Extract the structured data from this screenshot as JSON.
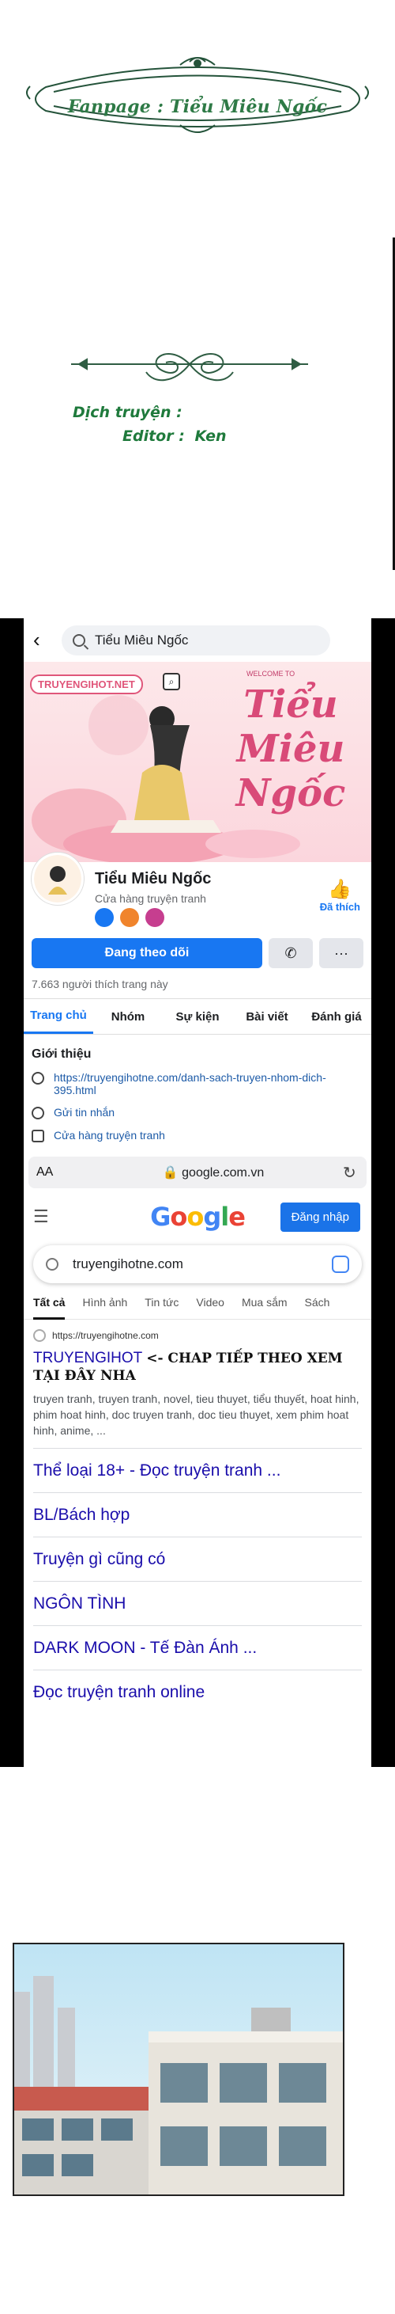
{
  "credits": {
    "fanpage": "Fanpage : Tiểu Miêu Ngốc",
    "translator_label": "Dịch truyện :",
    "editor_label": "Editor :",
    "editor_name": "Ken"
  },
  "facebook": {
    "search_query": "Tiểu Miêu Ngốc",
    "cover_badge": "TRUYENGIHOT.NET",
    "cover_welcome": "WELCOME TO",
    "cover_title": "Tiểu Miêu Ngốc",
    "page_name": "Tiểu Miêu Ngốc",
    "category": "Cửa hàng truyện tranh",
    "liked_label": "Đã thích",
    "follow_label": "Đang theo dõi",
    "likes_count": "7.663 người thích trang này",
    "tabs": [
      "Trang chủ",
      "Nhóm",
      "Sự kiện",
      "Bài viết",
      "Đánh giá"
    ],
    "intro_title": "Giới thiệu",
    "intro_link": "https://truyengihotne.com/danh-sach-truyen-nhom-dich-395.html",
    "intro_message": "Gửi tin nhắn",
    "intro_shop": "Cửa hàng truyện tranh"
  },
  "browser": {
    "aa": "AA",
    "domain": "google.com.vn"
  },
  "google": {
    "logo": [
      "G",
      "o",
      "o",
      "g",
      "l",
      "e"
    ],
    "signin_label": "Đăng nhập",
    "query": "truyengihotne.com",
    "tabs": [
      "Tất cả",
      "Hình ảnh",
      "Tin tức",
      "Video",
      "Mua sắm",
      "Sách"
    ],
    "result_site": "https://truyengihotne.com",
    "result_title": "TRUYENGIHOT",
    "result_note": "<- CHAP TIẾP THEO XEM TẠI ĐÂY NHA",
    "result_snippet": "truyen tranh, truyen tranh, novel, tieu thuyet, tiểu thuyết, hoat hinh, phim hoat hinh, doc truyen tranh, doc tieu thuyet, xem phim hoat hinh, anime, ...",
    "sublinks": [
      "Thể loại 18+ - Đọc truyện tranh ...",
      "BL/Bách hợp",
      "Truyện gì cũng có",
      "NGÔN TÌNH",
      "DARK MOON - Tế Đàn Ánh ...",
      "Đọc truyện tranh online"
    ]
  },
  "colors": {
    "facebook_blue": "#1877f2",
    "credit_green": "#1f7a3c",
    "google_link": "#1a0dab"
  }
}
